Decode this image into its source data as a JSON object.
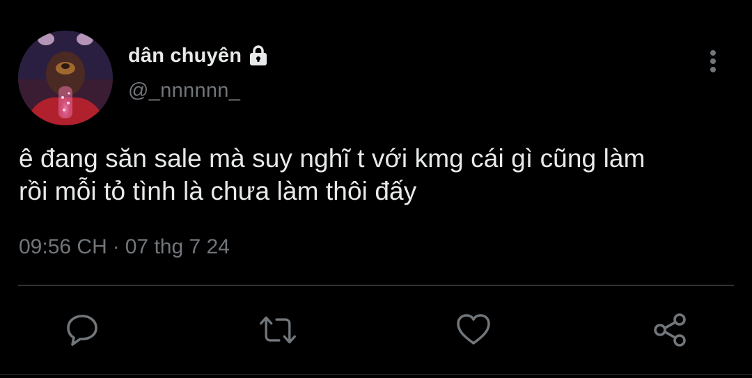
{
  "author": {
    "display_name": "dân chuyên",
    "handle": "@_nnnnnn_",
    "avatar_icon": "avatar-image",
    "lock_icon": "lock-icon"
  },
  "tweet": {
    "text_line_1": "ê đang săn sale mà suy nghĩ t với kmg cái gì cũng làm",
    "text_line_2": "rồi mỗi tỏ tình là chưa làm thôi đấy",
    "time": "09:56 CH",
    "separator": "·",
    "date": "07 thg 7 24"
  },
  "actions": [
    {
      "name": "reply",
      "icon": "comment-icon"
    },
    {
      "name": "retweet",
      "icon": "retweet-icon"
    },
    {
      "name": "like",
      "icon": "heart-icon"
    },
    {
      "name": "share",
      "icon": "share-icon"
    }
  ],
  "colors": {
    "background": "#000000",
    "primary_text": "#e7e9ea",
    "secondary_text": "#71767b",
    "divider": "#2f3336"
  }
}
